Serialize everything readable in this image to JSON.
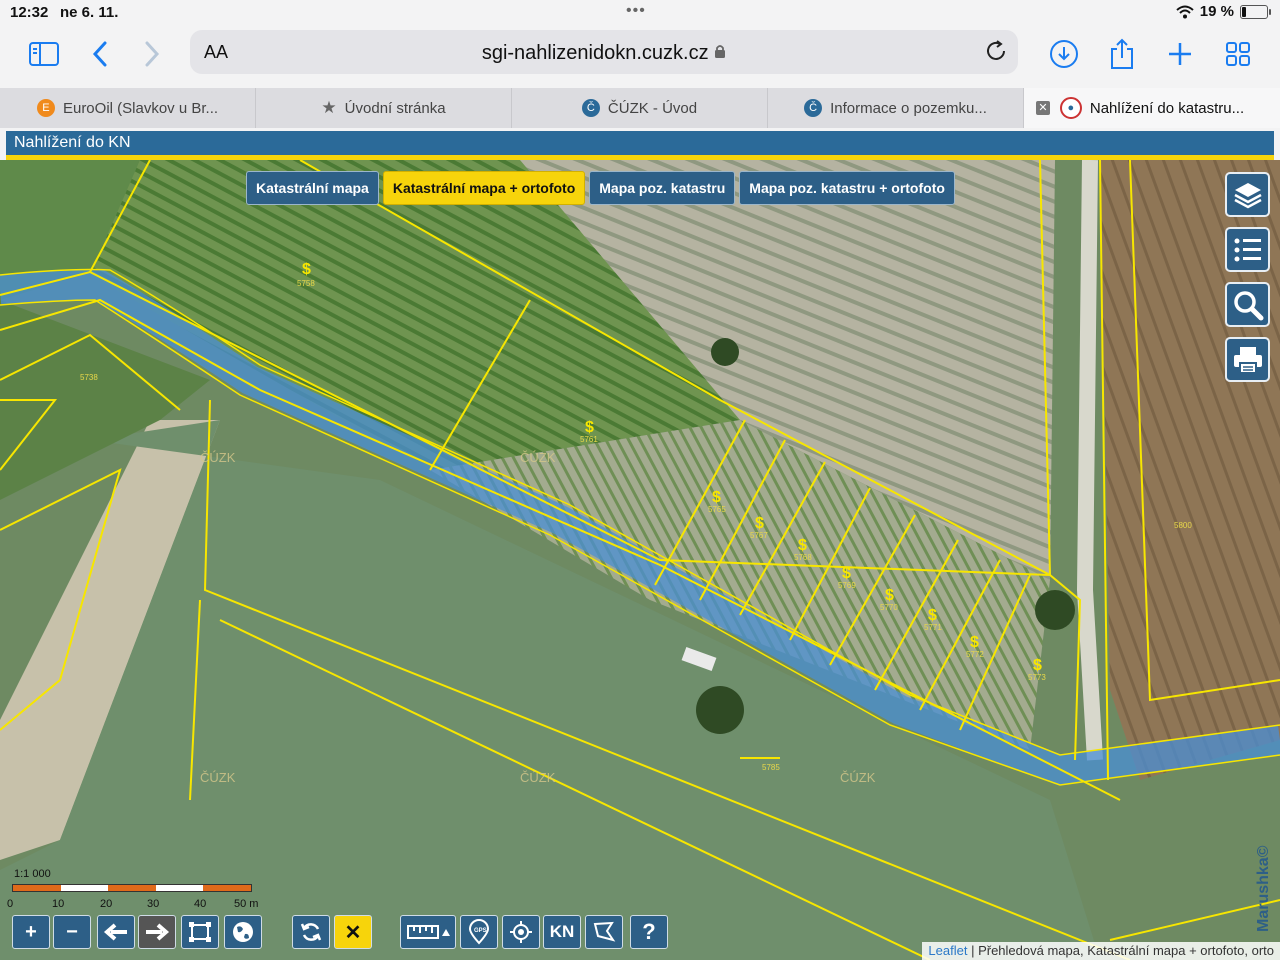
{
  "status_bar": {
    "time": "12:32",
    "date": "ne 6. 11.",
    "battery": "19 %"
  },
  "browser": {
    "text_size_label": "AA",
    "url": "sgi-nahlizenidokn.cuzk.cz",
    "tabs": [
      {
        "label": "EuroOil (Slavkov u Br...",
        "active": false
      },
      {
        "label": "Úvodní stránka",
        "active": false
      },
      {
        "label": "ČÚZK - Úvod",
        "active": false
      },
      {
        "label": "Informace o pozemku...",
        "active": false
      },
      {
        "label": "Nahlížení do katastru...",
        "active": true
      }
    ]
  },
  "app": {
    "title": "Nahlížení do KN"
  },
  "layers": {
    "buttons": [
      {
        "label": "Katastrální mapa",
        "active": false
      },
      {
        "label": "Katastrální mapa + ortofoto",
        "active": true
      },
      {
        "label": "Mapa poz. katastru",
        "active": false
      },
      {
        "label": "Mapa poz. katastru + ortofoto",
        "active": false
      }
    ]
  },
  "map": {
    "parcel_color": "#f7e600",
    "stream_color": "#4a8fd6",
    "watermark_labels": [
      "ČÚZK",
      "ČÚZK",
      "ČÚZK",
      "ČÚZK",
      "ČÚZK"
    ],
    "parcel_numbers": [
      "5758",
      "5738",
      "5761",
      "5765",
      "5767",
      "5768",
      "5769",
      "5770",
      "5771",
      "5772",
      "5773",
      "5785",
      "5800"
    ]
  },
  "side_tools": [
    "layers-icon",
    "legend-icon",
    "search-icon",
    "print-icon"
  ],
  "scale": {
    "ratio": "1:1 000",
    "ticks": [
      "0",
      "10",
      "20",
      "30",
      "40",
      "50 m"
    ]
  },
  "controls": {
    "kn_label": "KN",
    "help_label": "?"
  },
  "attribution": {
    "link": "Leaflet",
    "text": "| Přehledová mapa, Katastrální mapa + ortofoto, orto"
  },
  "watermark": "Marushka©"
}
